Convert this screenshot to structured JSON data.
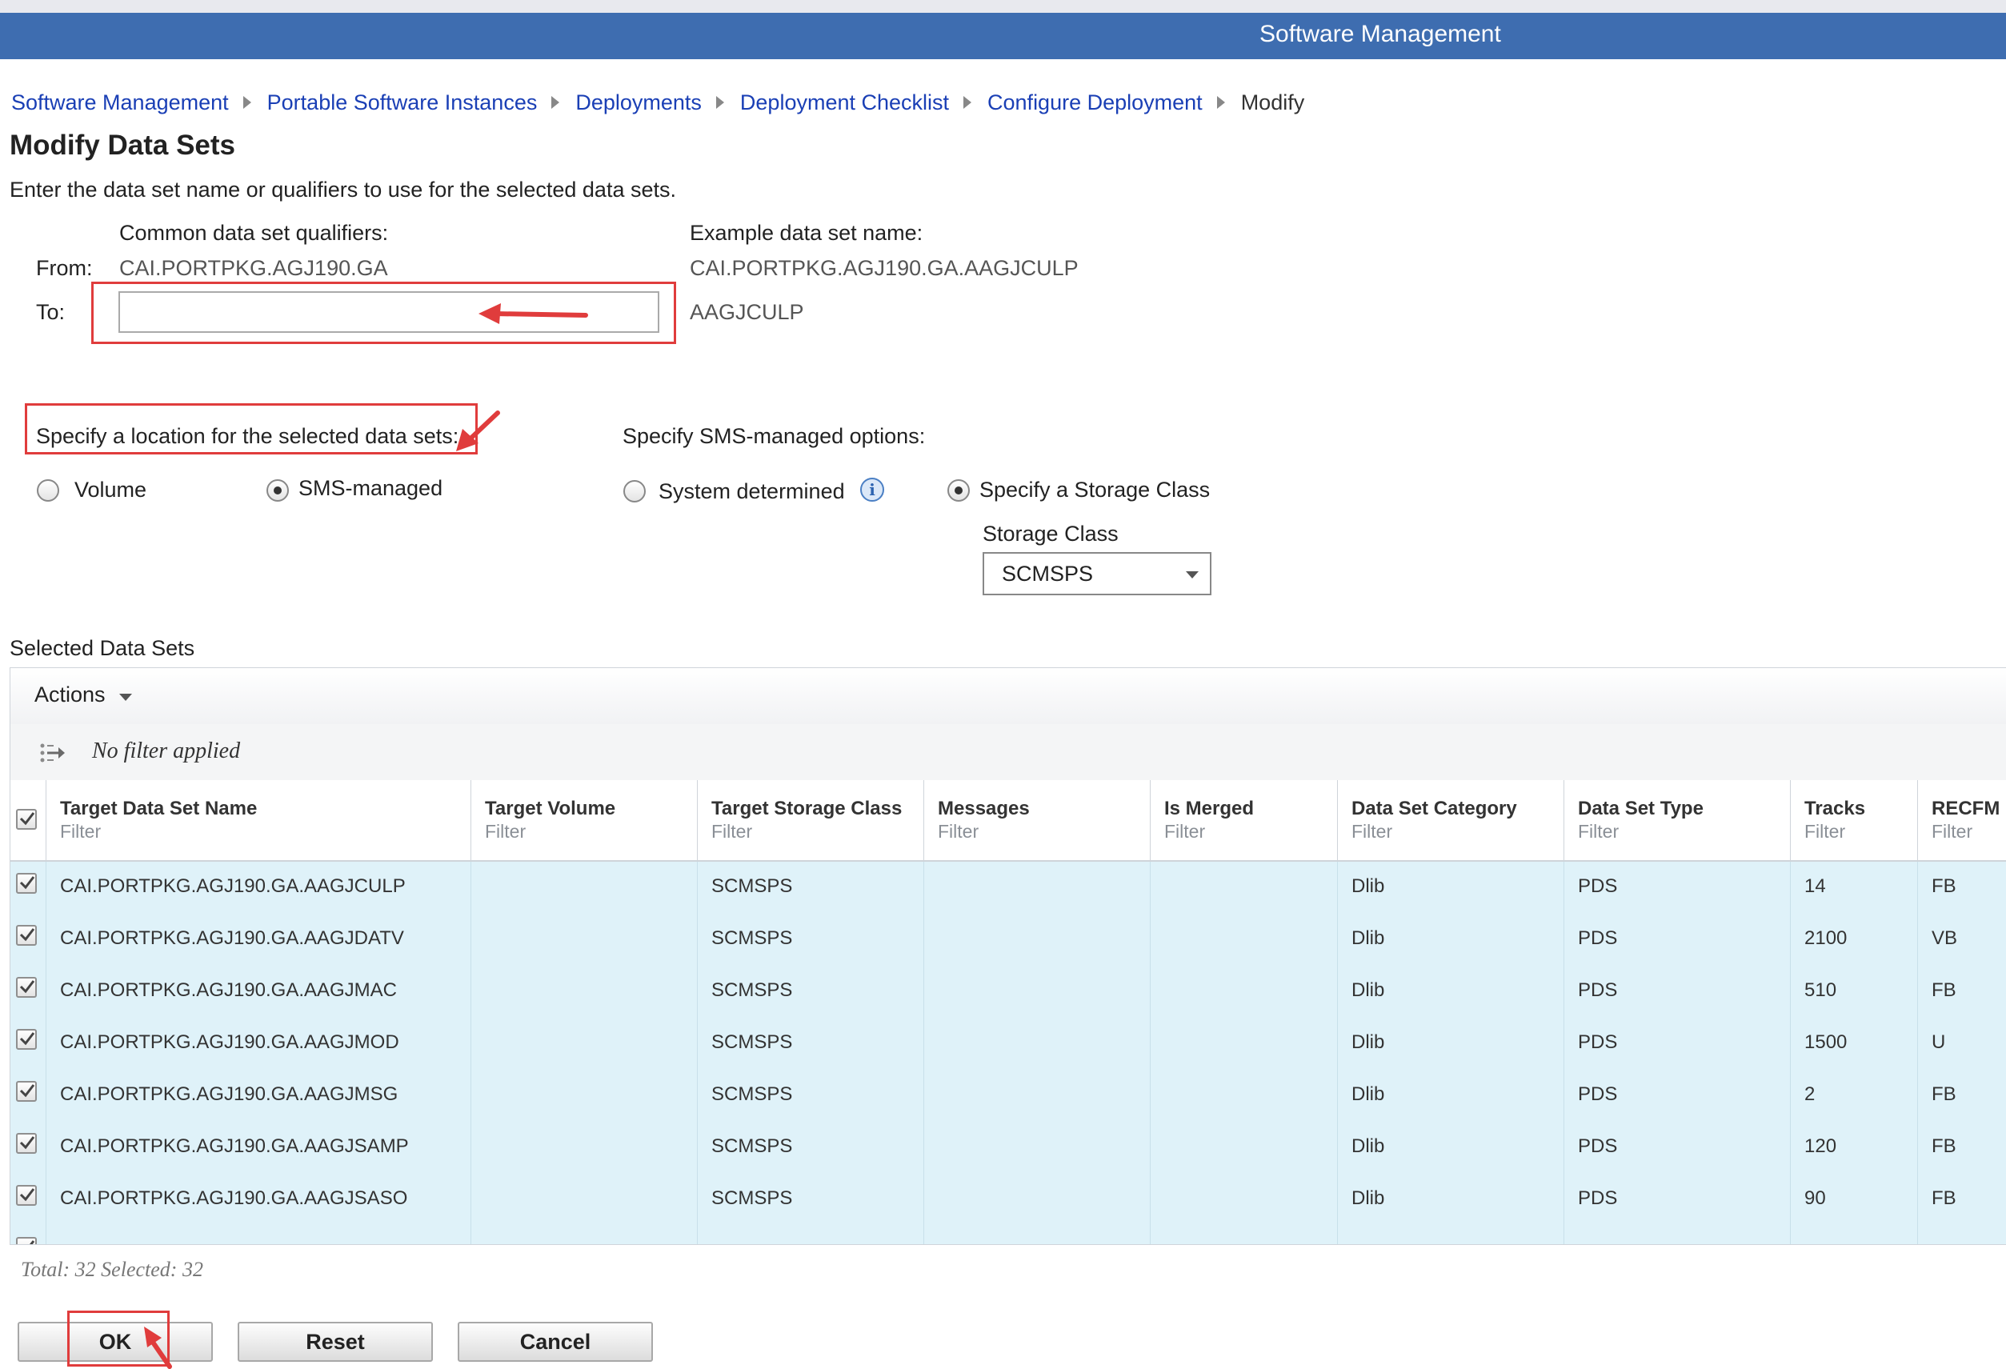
{
  "app": {
    "title": "Software Management"
  },
  "breadcrumb": {
    "items": [
      "Software Management",
      "Portable Software Instances",
      "Deployments",
      "Deployment Checklist",
      "Configure Deployment"
    ],
    "current": "Modify"
  },
  "page": {
    "title": "Modify Data Sets",
    "instructions": "Enter the data set name or qualifiers to use for the selected data sets."
  },
  "qualifiers": {
    "common_header": "Common data set qualifiers:",
    "example_header": "Example data set name:",
    "from_label": "From:",
    "from_value": "CAI.PORTPKG.AGJ190.GA",
    "from_example": "CAI.PORTPKG.AGJ190.GA.AAGJCULP",
    "to_label": "To:",
    "to_value": "",
    "to_example": "AAGJCULP"
  },
  "location": {
    "label": "Specify a location for the selected data sets:",
    "options": [
      {
        "label": "Volume",
        "selected": false
      },
      {
        "label": "SMS-managed",
        "selected": true
      }
    ]
  },
  "sms": {
    "label": "Specify SMS-managed options:",
    "options": [
      {
        "label": "System determined",
        "selected": false
      },
      {
        "label": "Specify a Storage Class",
        "selected": true
      }
    ],
    "storage_class_label": "Storage Class",
    "storage_class_value": "SCMSPS"
  },
  "grid": {
    "section_title": "Selected Data Sets",
    "actions_label": "Actions",
    "filter_status": "No filter applied",
    "filter_placeholder": "Filter",
    "columns": [
      "Target Data Set Name",
      "Target Volume",
      "Target Storage Class",
      "Messages",
      "Is Merged",
      "Data Set Category",
      "Data Set Type",
      "Tracks",
      "RECFM"
    ],
    "rows": [
      {
        "name": "CAI.PORTPKG.AGJ190.GA.AAGJCULP",
        "volume": "",
        "storage_class": "SCMSPS",
        "messages": "",
        "merged": "",
        "category": "Dlib",
        "type": "PDS",
        "tracks": "14",
        "recfm": "FB"
      },
      {
        "name": "CAI.PORTPKG.AGJ190.GA.AAGJDATV",
        "volume": "",
        "storage_class": "SCMSPS",
        "messages": "",
        "merged": "",
        "category": "Dlib",
        "type": "PDS",
        "tracks": "2100",
        "recfm": "VB"
      },
      {
        "name": "CAI.PORTPKG.AGJ190.GA.AAGJMAC",
        "volume": "",
        "storage_class": "SCMSPS",
        "messages": "",
        "merged": "",
        "category": "Dlib",
        "type": "PDS",
        "tracks": "510",
        "recfm": "FB"
      },
      {
        "name": "CAI.PORTPKG.AGJ190.GA.AAGJMOD",
        "volume": "",
        "storage_class": "SCMSPS",
        "messages": "",
        "merged": "",
        "category": "Dlib",
        "type": "PDS",
        "tracks": "1500",
        "recfm": "U"
      },
      {
        "name": "CAI.PORTPKG.AGJ190.GA.AAGJMSG",
        "volume": "",
        "storage_class": "SCMSPS",
        "messages": "",
        "merged": "",
        "category": "Dlib",
        "type": "PDS",
        "tracks": "2",
        "recfm": "FB"
      },
      {
        "name": "CAI.PORTPKG.AGJ190.GA.AAGJSAMP",
        "volume": "",
        "storage_class": "SCMSPS",
        "messages": "",
        "merged": "",
        "category": "Dlib",
        "type": "PDS",
        "tracks": "120",
        "recfm": "FB"
      },
      {
        "name": "CAI.PORTPKG.AGJ190.GA.AAGJSASO",
        "volume": "",
        "storage_class": "SCMSPS",
        "messages": "",
        "merged": "",
        "category": "Dlib",
        "type": "PDS",
        "tracks": "90",
        "recfm": "FB"
      }
    ],
    "status": "Total: 32 Selected: 32"
  },
  "buttons": {
    "ok": "OK",
    "reset": "Reset",
    "cancel": "Cancel"
  },
  "colors": {
    "titlebar": "#3e6db0",
    "link": "#1a3fb5",
    "row_bg": "#dff2f9",
    "annotation": "#e03c3c"
  }
}
